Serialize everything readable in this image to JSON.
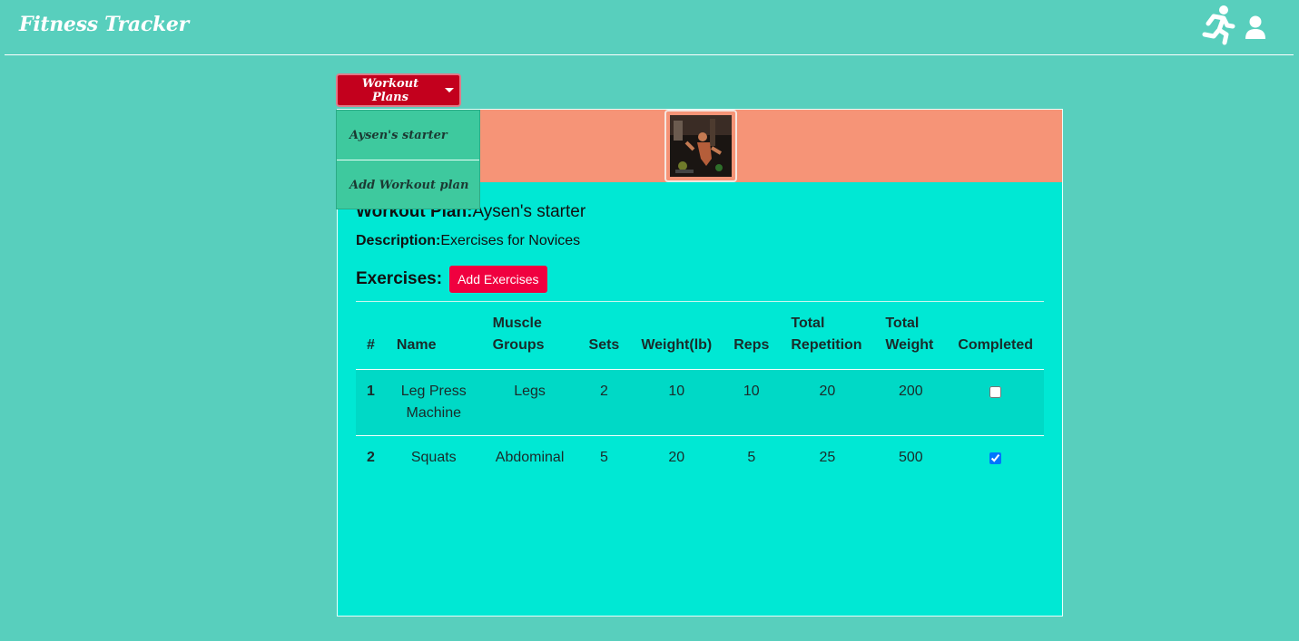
{
  "navbar": {
    "brand": "Fitness Tracker",
    "icons": [
      "running-icon",
      "user-icon"
    ]
  },
  "dropdown": {
    "label": "Workout Plans",
    "items": [
      "Aysen's starter",
      "Add Workout plan"
    ]
  },
  "plan": {
    "title_label": "Workout Plan:",
    "title_value": "Aysen's starter",
    "desc_label": "Description:",
    "desc_value": "Exercises for Novices",
    "exercises_label": "Exercises:",
    "add_button": "Add Exercises"
  },
  "table": {
    "headers": [
      "#",
      "Name",
      "Muscle Groups",
      "Sets",
      "Weight(lb)",
      "Reps",
      "Total Repetition",
      "Total Weight",
      "Completed"
    ],
    "rows": [
      {
        "num": "1",
        "name": "Leg Press Machine",
        "muscle": "Legs",
        "sets": "2",
        "weight": "10",
        "reps": "10",
        "total_rep": "20",
        "total_weight": "200",
        "completed": false
      },
      {
        "num": "2",
        "name": "Squats",
        "muscle": "Abdominal",
        "sets": "5",
        "weight": "20",
        "reps": "5",
        "total_rep": "25",
        "total_weight": "500",
        "completed": true
      }
    ]
  },
  "colors": {
    "page_bg": "#58cfbd",
    "card_bg": "#00e8d4",
    "card_header": "#f69477",
    "dropdown_button": "#c3001d",
    "add_button": "#f0003f"
  }
}
